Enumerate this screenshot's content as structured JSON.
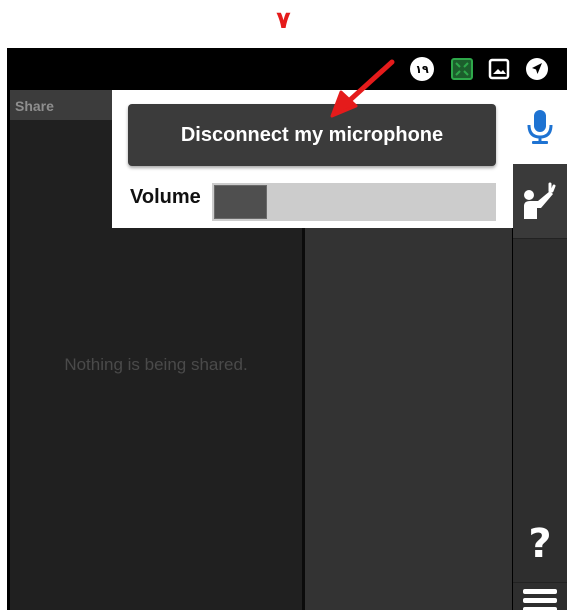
{
  "step": {
    "number": "۷"
  },
  "status_bar": {
    "badge_text": "۱۹",
    "icons": [
      "notification-count-icon",
      "fullscreen-toggle-icon",
      "image-icon",
      "location-arrow-icon"
    ]
  },
  "share": {
    "title": "Share",
    "empty_message": "Nothing is being shared."
  },
  "audio_popover": {
    "disconnect_label": "Disconnect my microphone",
    "volume_label": "Volume",
    "volume_level": 0.19
  },
  "right_rail": {
    "items": [
      "microphone-icon",
      "raise-hand-icon",
      "help-icon",
      "menu-icon"
    ],
    "help_label": "?"
  },
  "colors": {
    "accent_blue": "#1e73d2",
    "annotation_red": "#e51b1b",
    "fullscreen_green": "#2ea84a"
  }
}
